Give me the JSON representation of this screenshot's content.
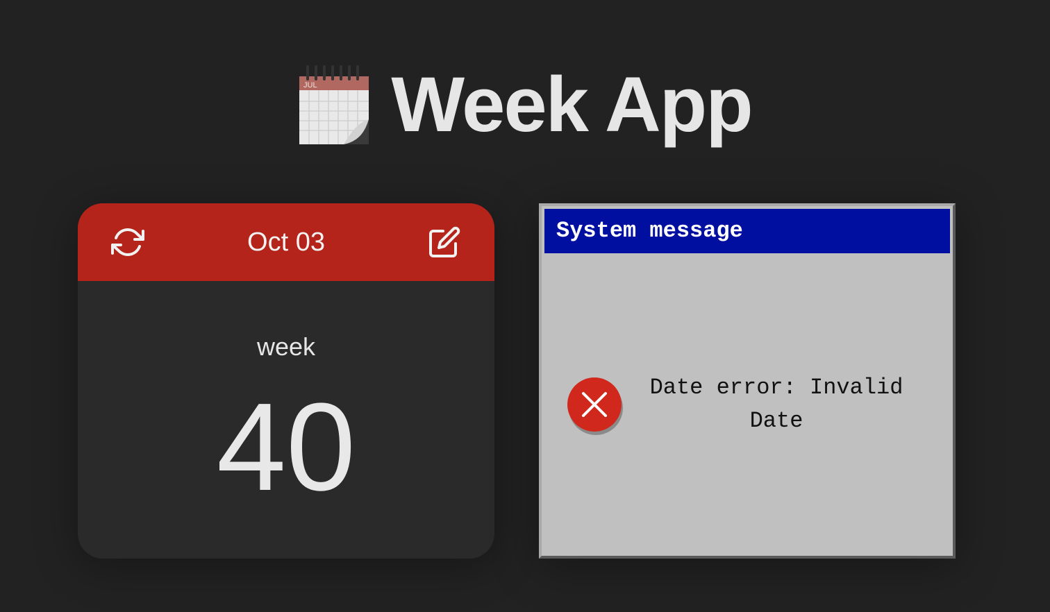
{
  "app": {
    "title": "Week App",
    "title_icon": "calendar-icon",
    "title_icon_month": "JUL"
  },
  "week_card": {
    "date": "Oct 03",
    "week_label": "week",
    "week_number": "40",
    "refresh_icon": "refresh-icon",
    "edit_icon": "edit-icon",
    "header_color": "#b4241a"
  },
  "dialog": {
    "title": "System message",
    "message": "Date error: Invalid Date",
    "icon": "error-icon",
    "titlebar_color": "#000fa0"
  }
}
